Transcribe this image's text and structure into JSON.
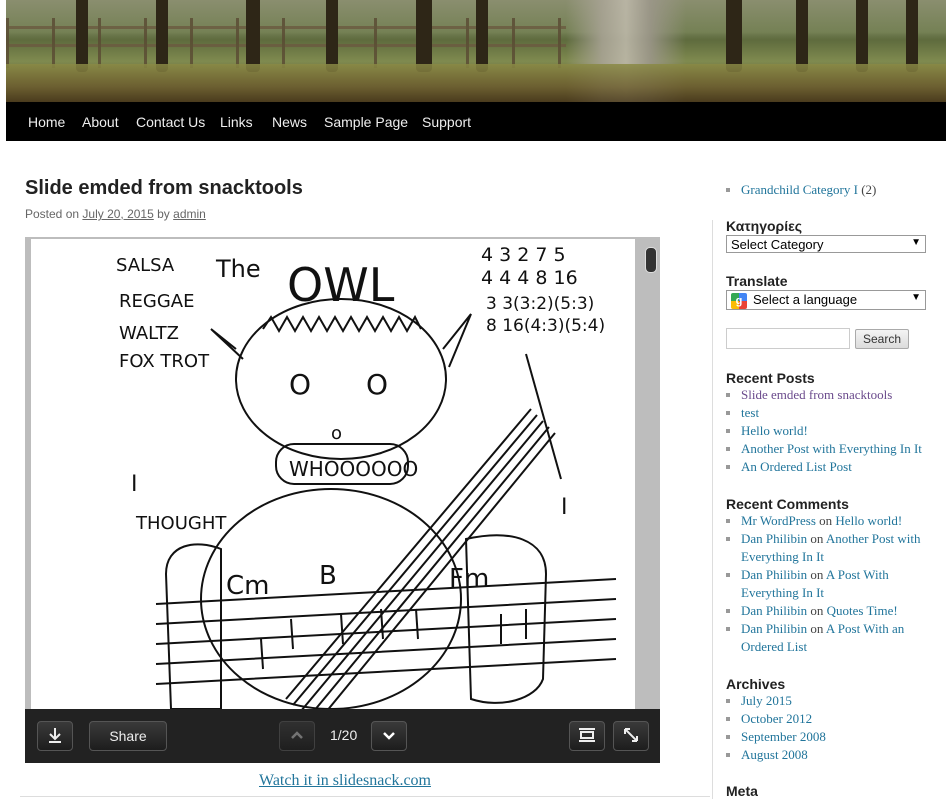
{
  "nav": {
    "items": [
      "Home",
      "About",
      "Contact Us",
      "Links",
      "News",
      "Sample Page",
      "Support"
    ]
  },
  "post": {
    "title": "Slide emded from snacktools",
    "posted_on": "Posted on",
    "date": "July 20, 2015",
    "by": "by",
    "author": "admin"
  },
  "slide": {
    "sketch_texts": [
      "SALSA",
      "REGGAE",
      "WALTZ",
      "FOX TROT",
      "The",
      "OWL",
      "WHOOOOOO",
      "I",
      "THOUGHT",
      "I",
      "Cm",
      "B",
      "Fm",
      "4 3 2 7 5",
      "4 4 4 8 16",
      "3 3(3:2)(5:3)",
      "8 16(4:3)(5:4)",
      "O",
      "O",
      "o"
    ],
    "share_label": "Share",
    "counter": "1/20",
    "watch_link": "Watch it in slidesnack.com"
  },
  "sidebar": {
    "grandchild": {
      "label": "Grandchild Category I",
      "count": "(2)"
    },
    "categories": {
      "title": "Κατηγορίες",
      "select_value": "Select Category"
    },
    "translate": {
      "title": "Translate",
      "select_value": "Select a language"
    },
    "search": {
      "button": "Search"
    },
    "recent_posts": {
      "title": "Recent Posts",
      "items": [
        "Slide emded from snacktools",
        "test",
        "Hello world!",
        "Another Post with Everything In It",
        "An Ordered List Post"
      ]
    },
    "recent_comments": {
      "title": "Recent Comments",
      "on": "on",
      "items": [
        {
          "author": "Mr WordPress",
          "post": "Hello world!"
        },
        {
          "author": "Dan Philibin",
          "post_a": "Another Post with",
          "post_b": "Everything In It"
        },
        {
          "author": "Dan Philibin",
          "post_a": "A Post With",
          "post_b": "Everything In It"
        },
        {
          "author": "Dan Philibin",
          "post": "Quotes Time!"
        },
        {
          "author": "Dan Philibin",
          "post_a": "A Post With an",
          "post_b": "Ordered List"
        }
      ]
    },
    "archives": {
      "title": "Archives",
      "items": [
        "July 2015",
        "October 2012",
        "September 2008",
        "August 2008"
      ]
    },
    "meta": {
      "title": "Meta"
    }
  },
  "colors": {
    "link": "#21759b",
    "nav_bg": "#000000",
    "toolbar_bg": "#222222"
  }
}
